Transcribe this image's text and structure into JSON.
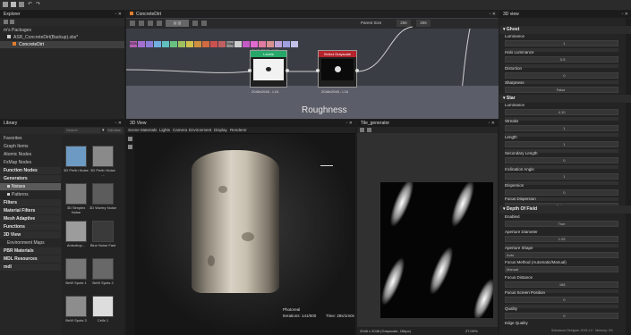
{
  "explorer": {
    "title": "Explorer",
    "items": [
      "m's Packages",
      "ASR_ConcreteDirt(Backup).sbs*",
      "ConcreteDirt"
    ]
  },
  "graph": {
    "tab": "ConcreteDirt",
    "toolbar_labels": [
      "RGBA",
      "Gray",
      "Mask",
      "F",
      "H",
      "SGG"
    ],
    "toolbar_right": [
      "Parent Size",
      "256",
      "256"
    ],
    "frame_label": "Roughness",
    "top_resolution": "2048x2048 - L16",
    "node_levels": {
      "title": "Levels",
      "res": "2048x2048 - L16"
    },
    "node_select": {
      "title": "Select Grayscale",
      "res": "2048x2048 - L16"
    }
  },
  "library": {
    "title": "Library",
    "search_placeholder": "Search",
    "view_label": "Grid view",
    "tree": [
      {
        "label": "Favorites",
        "type": "item"
      },
      {
        "label": "Graph Items",
        "type": "item"
      },
      {
        "label": "Atomic Nodes",
        "type": "item"
      },
      {
        "label": "FxMap Nodes",
        "type": "item"
      },
      {
        "label": "Function Nodes",
        "type": "sec"
      },
      {
        "label": "Generators",
        "type": "sec"
      },
      {
        "label": "Noises",
        "type": "sel"
      },
      {
        "label": "Patterns",
        "type": "item"
      },
      {
        "label": "Filters",
        "type": "sec"
      },
      {
        "label": "Material Filters",
        "type": "sec"
      },
      {
        "label": "Mesh Adaptive",
        "type": "sec"
      },
      {
        "label": "Functions",
        "type": "sec"
      },
      {
        "label": "3D View",
        "type": "sec"
      },
      {
        "label": "Environment Maps",
        "type": "item"
      },
      {
        "label": "PBR Materials",
        "type": "sec"
      },
      {
        "label": "MDL Resources",
        "type": "sec"
      },
      {
        "label": "mdl",
        "type": "sec"
      }
    ],
    "thumbs": [
      {
        "label": "3D Perlin Noise",
        "color": "#6d9ac2"
      },
      {
        "label": "3D Perlin Noise ...",
        "color": "#8a8a8a"
      },
      {
        "label": "3D Simplex Noise",
        "color": "#7b7b7b"
      },
      {
        "label": "3D Worley Noise",
        "color": "#5c5c5c"
      },
      {
        "label": "Anisotrop...",
        "color": "#9c9c9c"
      },
      {
        "label": "Blue Noise Fast",
        "color": "#3a3a3a"
      },
      {
        "label": "BnW Spots 1",
        "color": "#777777"
      },
      {
        "label": "BnW Spots 2",
        "color": "#686868"
      },
      {
        "label": "BnW Spots 3",
        "color": "#8d8d8d"
      },
      {
        "label": "Cells 1",
        "color": "#dddddd"
      }
    ]
  },
  "view3d": {
    "title": "3D View",
    "menu": [
      "Scene",
      "Materials",
      "Lights",
      "Camera",
      "Environment",
      "Display",
      "Renderer"
    ],
    "status_mode": "Photoreal",
    "iterations": "Iterations: 141/500",
    "time": "Time: 28s/1m0s"
  },
  "view2d": {
    "title": "Tile_generator",
    "footer_info": "2048 x 2048 (Grayscale, 16bpc)",
    "zoom": "27.09%"
  },
  "params": {
    "title": "3D view",
    "ghost_section": "Ghost",
    "glare_section": "Star",
    "dof_section": "Depth Of Field",
    "ghost_props": [
      {
        "label": "Luminance",
        "value": "1"
      },
      {
        "label": "Halo Luminance",
        "value": "0.5"
      },
      {
        "label": "Distortion",
        "value": "0"
      },
      {
        "label": "Sharpness",
        "value": "False"
      }
    ],
    "star_props": [
      {
        "label": "Luminance",
        "value": "4.10"
      },
      {
        "label": "Streaks",
        "value": "1"
      },
      {
        "label": "Length",
        "value": "1"
      },
      {
        "label": "Secondary Length",
        "value": "0"
      },
      {
        "label": "Inclination Angle",
        "value": "1"
      },
      {
        "label": "Dispersion",
        "value": "0"
      },
      {
        "label": "Focus Dispersion",
        "value": "False"
      }
    ],
    "dof_props": [
      {
        "label": "Enabled",
        "value": "True"
      },
      {
        "label": "Aperture Diameter",
        "value": "1.25"
      },
      {
        "label": "Aperture Shape",
        "value": "Auto"
      },
      {
        "label": "Focus Method (Automatic/Manual)",
        "value": "Manual"
      },
      {
        "label": "Focus Distance",
        "value": "168"
      },
      {
        "label": "Focus Screen Position",
        "value": "0"
      },
      {
        "label": "Quality",
        "value": "0"
      },
      {
        "label": "Edge Quality",
        "value": ""
      }
    ]
  },
  "status_bar": {
    "text": "Substance Designer 2019.1.0 · Memory: 0%"
  }
}
